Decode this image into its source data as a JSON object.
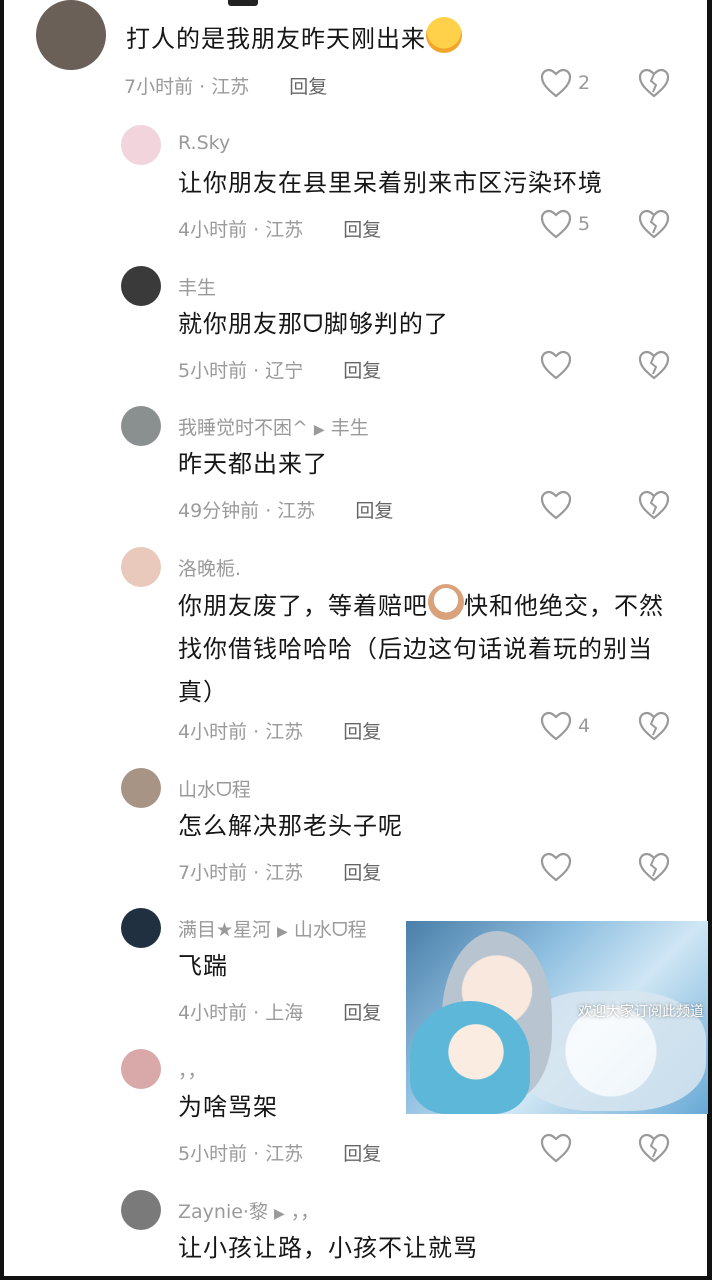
{
  "comments": [
    {
      "username": "",
      "content": "打人的是我朋友昨天刚出来",
      "time_loc": "7小时前 · 江苏",
      "reply": "回复",
      "likes": "2",
      "avatar": "#6b6058"
    },
    {
      "username": "R.Sky",
      "content": "让你朋友在县里呆着别来市区污染环境",
      "time_loc": "4小时前 · 江苏",
      "reply": "回复",
      "likes": "5",
      "avatar": "#f2d4dc"
    },
    {
      "username": "丰生",
      "content": "就你朋友那ᗜ脚够判的了",
      "time_loc": "5小时前 · 辽宁",
      "reply": "回复",
      "likes": "",
      "avatar": "#3a3a3a"
    },
    {
      "username": "我睡觉时不困^",
      "reply_to": "丰生",
      "content": "昨天都出来了",
      "time_loc": "49分钟前 · 江苏",
      "reply": "回复",
      "likes": "",
      "avatar": "#8a8f90"
    },
    {
      "username": "洛晚栀.",
      "content": "你朋友废了，等着赔吧",
      "content_2": "快和他绝交，不然找你借钱哈哈哈（后边这句话说着玩的别当真）",
      "time_loc": "4小时前 · 江苏",
      "reply": "回复",
      "likes": "4",
      "avatar": "#e8c9bc"
    },
    {
      "username": "山水ᗜ程",
      "content": "怎么解决那老头子呢",
      "time_loc": "7小时前 · 江苏",
      "reply": "回复",
      "likes": "",
      "avatar": "#a89484"
    },
    {
      "username": "满目★星河",
      "reply_to": "山水ᗜ程",
      "content": "飞踹",
      "time_loc": "4小时前 · 上海",
      "reply": "回复",
      "likes": "",
      "avatar": "#203040"
    },
    {
      "username": "，，",
      "content": "为啥骂架",
      "time_loc": "5小时前 · 江苏",
      "reply": "回复",
      "likes": "",
      "avatar": "#d9a8a8"
    },
    {
      "username": "Zaynie·黎",
      "reply_to": "，，",
      "content": "让小孩让路，小孩不让就骂",
      "avatar": "#7a7a7a"
    }
  ],
  "overlay": {
    "caption": "欢迎大家订阅此频道"
  },
  "colors": {
    "meta": "#9a9a9a",
    "text": "#161616",
    "background": "#ffffff"
  },
  "icons": {
    "like": "heart-outline-icon",
    "dislike": "broken-heart-outline-icon",
    "reply_arrow": "play-triangle-icon"
  }
}
